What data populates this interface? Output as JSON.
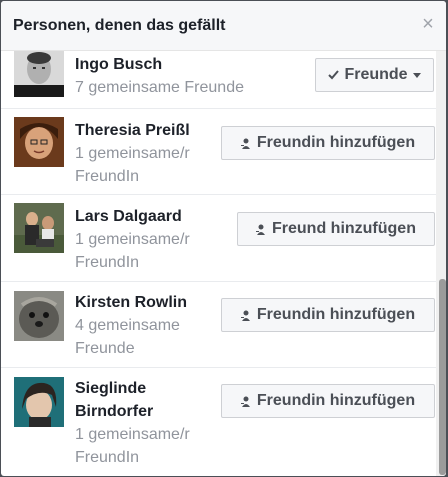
{
  "dialog": {
    "title": "Personen, denen das gefällt",
    "close_label": "×"
  },
  "people": [
    {
      "name": "Ingo Busch",
      "mutual": "7 gemeinsame Freunde",
      "button": "Freunde",
      "button_icon": "checkmark-icon"
    },
    {
      "name": "Theresia Preißl",
      "mutual_line1": "1 gemeinsame/r",
      "mutual_line2": "FreundIn",
      "button": "Freundin hinzufügen",
      "button_icon": "add-friend-icon"
    },
    {
      "name": "Lars Dalgaard",
      "mutual_line1": "1 gemeinsame/r",
      "mutual_line2": "FreundIn",
      "button": "Freund hinzufügen",
      "button_icon": "add-friend-icon"
    },
    {
      "name": "Kirsten Rowlin",
      "mutual_line1": "4 gemeinsame",
      "mutual_line2": "Freunde",
      "button": "Freundin hinzufügen",
      "button_icon": "add-friend-icon"
    },
    {
      "name_line1": "Sieglinde",
      "name_line2": "Birndorfer",
      "mutual_line1": "1 gemeinsame/r",
      "mutual_line2": "FreundIn",
      "button": "Freundin hinzufügen",
      "button_icon": "add-friend-icon"
    }
  ]
}
